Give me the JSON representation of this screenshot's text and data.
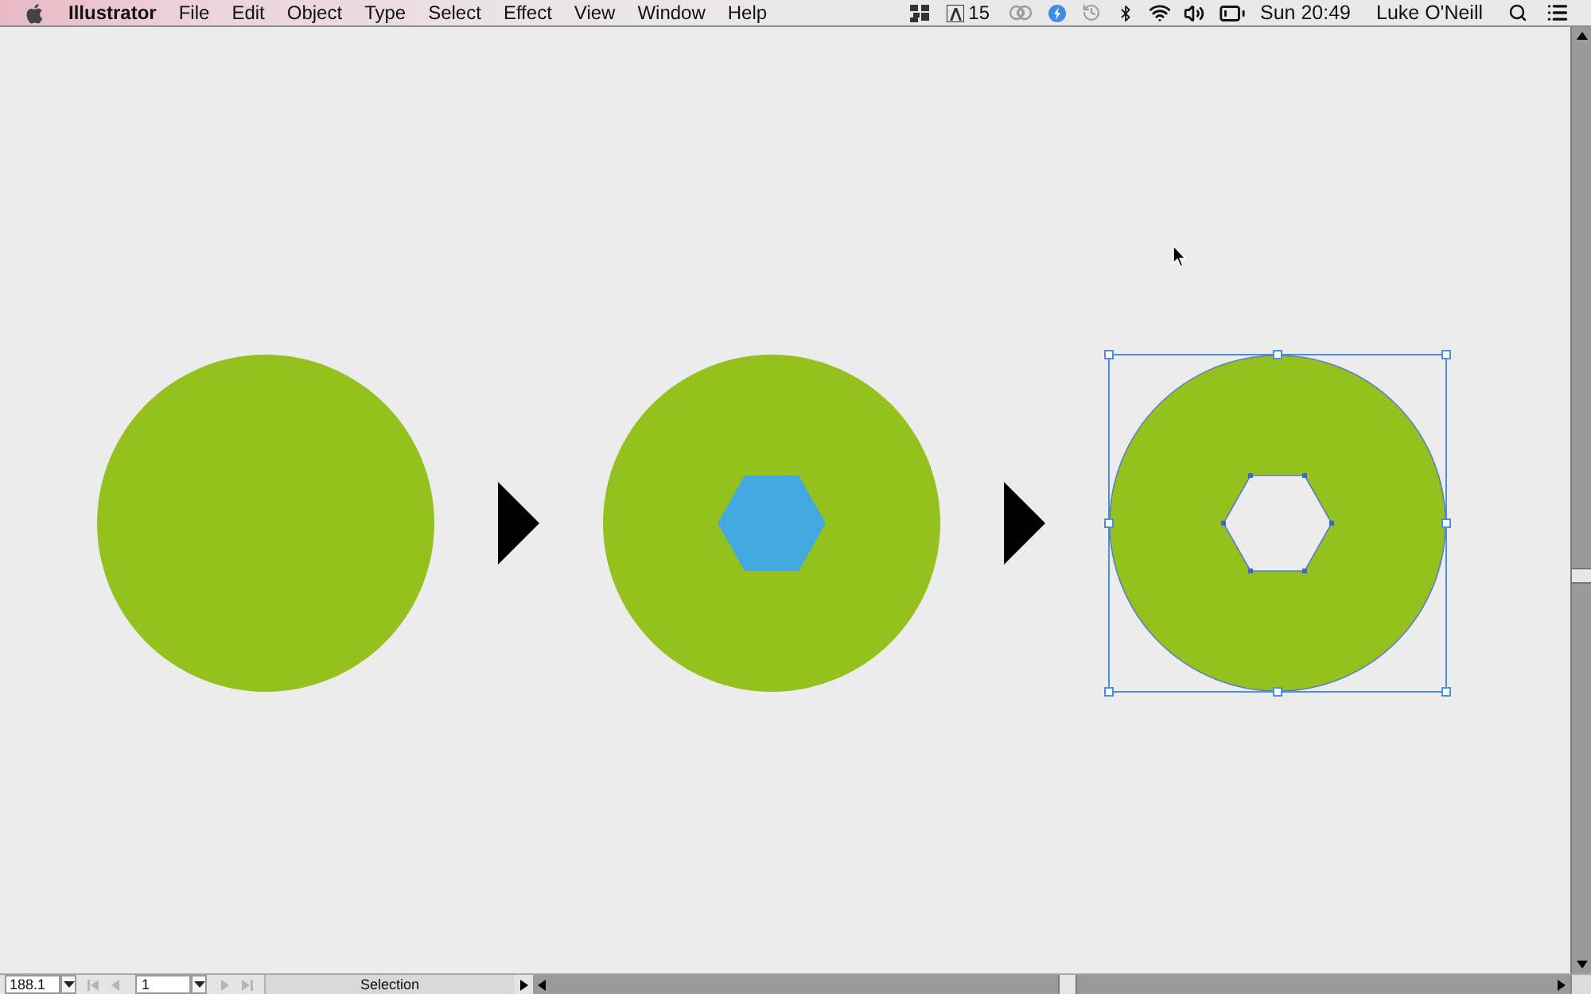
{
  "menu_bar": {
    "app_name": "Illustrator",
    "menus": [
      "File",
      "Edit",
      "Object",
      "Type",
      "Select",
      "Effect",
      "View",
      "Window",
      "Help"
    ],
    "badge_count": "15",
    "clock": "Sun 20:49",
    "user": "Luke O'Neill"
  },
  "canvas": {
    "artwork": [
      {
        "kind": "circle",
        "selected": false
      },
      {
        "kind": "arrow",
        "selected": false
      },
      {
        "kind": "circle_with_hexagon",
        "selected": false
      },
      {
        "kind": "arrow",
        "selected": false
      },
      {
        "kind": "ring",
        "selected": true
      }
    ]
  },
  "status_bar": {
    "zoom": "188.1",
    "nav_back": [
      {
        "kind": "first",
        "disabled": true
      },
      {
        "kind": "previous",
        "disabled": true
      }
    ],
    "page": "1",
    "nav_forward": [
      {
        "kind": "next",
        "disabled": true
      },
      {
        "kind": "last",
        "disabled": true
      }
    ],
    "status": "Selection"
  }
}
